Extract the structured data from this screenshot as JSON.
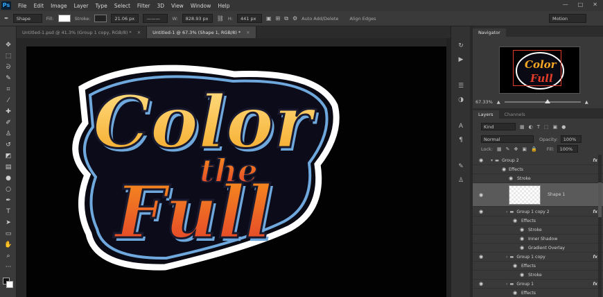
{
  "app": {
    "logo": "Ps"
  },
  "menu": [
    "File",
    "Edit",
    "Image",
    "Layer",
    "Type",
    "Select",
    "Filter",
    "3D",
    "View",
    "Window",
    "Help"
  ],
  "window_controls": [
    "—",
    "□",
    "✕"
  ],
  "options_bar": {
    "tool_mode": "Shape",
    "fill_label": "Fill:",
    "stroke_label": "Stroke:",
    "stroke_size": "21.06 px",
    "w_label": "W:",
    "w_value": "828.93 px",
    "h_label": "H:",
    "h_value": "441 px",
    "auto_add": "Auto Add/Delete",
    "align_edges": "Align Edges",
    "workspace": "Motion",
    "fill_color": "#ffffff"
  },
  "tabs": [
    {
      "label": "Untitled-1.psd @ 41.3% (Group 1 copy, RGB/8) *",
      "active": false,
      "close": "✕"
    },
    {
      "label": "Untitled-1 @ 67.3% (Shape 1, RGB/8) *",
      "active": true,
      "close": "✕"
    }
  ],
  "artwork": {
    "line1": "Color",
    "line2": "the",
    "line3": "Full"
  },
  "navigator": {
    "tabs": [
      "Navigator"
    ],
    "zoom": "67.33%",
    "thumb_line1": "Color",
    "thumb_line2": "Full"
  },
  "layers": {
    "tabs": [
      "Layers",
      "Channels"
    ],
    "kind": "Kind",
    "blend_mode": "Normal",
    "opacity_label": "Opacity:",
    "opacity_value": "100%",
    "lock_label": "Lock:",
    "fill_label": "Fill:",
    "fill_value": "100%",
    "items": [
      {
        "name": "Group 2",
        "type": "group",
        "fx": true
      },
      {
        "name": "Effects",
        "type": "effects"
      },
      {
        "name": "Stroke",
        "type": "effect"
      },
      {
        "name": "Shape 1",
        "type": "shape",
        "selected": true
      },
      {
        "name": "Group 1 copy 2",
        "type": "group",
        "fx": true
      },
      {
        "name": "Effects",
        "type": "effects"
      },
      {
        "name": "Stroke",
        "type": "effect"
      },
      {
        "name": "Inner Shadow",
        "type": "effect"
      },
      {
        "name": "Gradient Overlay",
        "type": "effect"
      },
      {
        "name": "Group 1 copy",
        "type": "group",
        "fx": true
      },
      {
        "name": "Effects",
        "type": "effects"
      },
      {
        "name": "Stroke",
        "type": "effect"
      },
      {
        "name": "Group 1",
        "type": "group",
        "fx": true
      },
      {
        "name": "Effects",
        "type": "effects"
      }
    ]
  },
  "colors": {
    "accent_orange": "#f5a623",
    "accent_red": "#e23c2a",
    "outline_blue": "#6fa8dc"
  }
}
